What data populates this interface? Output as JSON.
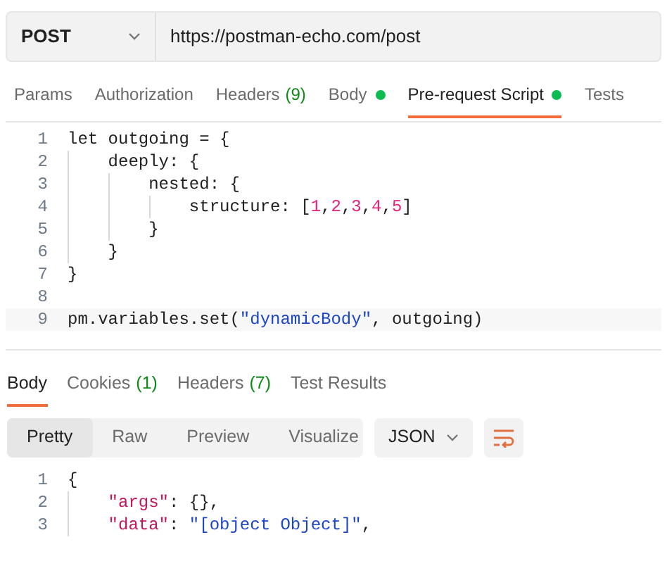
{
  "request": {
    "method": "POST",
    "url": "https://postman-echo.com/post"
  },
  "request_tabs": [
    {
      "label": "Params",
      "selected": false
    },
    {
      "label": "Authorization",
      "selected": false
    },
    {
      "label": "Headers",
      "count": "(9)",
      "selected": false
    },
    {
      "label": "Body",
      "dot": true,
      "selected": false
    },
    {
      "label": "Pre-request Script",
      "dot": true,
      "selected": true
    },
    {
      "label": "Tests",
      "selected": false
    }
  ],
  "script_editor": {
    "lines": [
      {
        "number": "1",
        "tokens": [
          {
            "text": "let outgoing = {",
            "kind": "plain"
          }
        ]
      },
      {
        "number": "2",
        "tokens": [
          {
            "text": "    deeply: {",
            "kind": "plain"
          }
        ]
      },
      {
        "number": "3",
        "tokens": [
          {
            "text": "        nested: {",
            "kind": "plain"
          }
        ]
      },
      {
        "number": "4",
        "tokens": [
          {
            "text": "            structure: [",
            "kind": "plain"
          },
          {
            "text": "1",
            "kind": "number"
          },
          {
            "text": ",",
            "kind": "plain"
          },
          {
            "text": "2",
            "kind": "number"
          },
          {
            "text": ",",
            "kind": "plain"
          },
          {
            "text": "3",
            "kind": "number"
          },
          {
            "text": ",",
            "kind": "plain"
          },
          {
            "text": "4",
            "kind": "number"
          },
          {
            "text": ",",
            "kind": "plain"
          },
          {
            "text": "5",
            "kind": "number"
          },
          {
            "text": "]",
            "kind": "plain"
          }
        ]
      },
      {
        "number": "5",
        "tokens": [
          {
            "text": "        }",
            "kind": "plain"
          }
        ]
      },
      {
        "number": "6",
        "tokens": [
          {
            "text": "    }",
            "kind": "plain"
          }
        ]
      },
      {
        "number": "7",
        "tokens": [
          {
            "text": "}",
            "kind": "plain"
          }
        ]
      },
      {
        "number": "8"
      },
      {
        "number": "9",
        "tokens": [
          {
            "text": "pm.variables.set(",
            "kind": "plain"
          },
          {
            "text": "\"dynamicBody\"",
            "kind": "string"
          },
          {
            "text": ", outgoing)",
            "kind": "plain"
          }
        ]
      }
    ]
  },
  "response_tabs": [
    {
      "label": "Body",
      "selected": true
    },
    {
      "label": "Cookies",
      "count": "(1)",
      "selected": false
    },
    {
      "label": "Headers",
      "count": "(7)",
      "selected": false
    },
    {
      "label": "Test Results",
      "selected": false
    }
  ],
  "view_modes": [
    {
      "label": "Pretty",
      "selected": true
    },
    {
      "label": "Raw",
      "selected": false
    },
    {
      "label": "Preview",
      "selected": false
    },
    {
      "label": "Visualize",
      "selected": false
    }
  ],
  "format": "JSON",
  "response_body": {
    "lines": [
      {
        "number": "1",
        "tokens": [
          {
            "text": "{",
            "kind": "plain"
          }
        ]
      },
      {
        "number": "2",
        "tokens": [
          {
            "text": "    \"args\"",
            "kind": "key"
          },
          {
            "text": ": {},",
            "kind": "plain"
          }
        ]
      },
      {
        "number": "3",
        "tokens": [
          {
            "text": "    \"data\"",
            "kind": "key"
          },
          {
            "text": ": ",
            "kind": "plain"
          },
          {
            "text": "\"[object Object]\"",
            "kind": "string"
          },
          {
            "text": ",",
            "kind": "plain"
          }
        ]
      }
    ]
  }
}
